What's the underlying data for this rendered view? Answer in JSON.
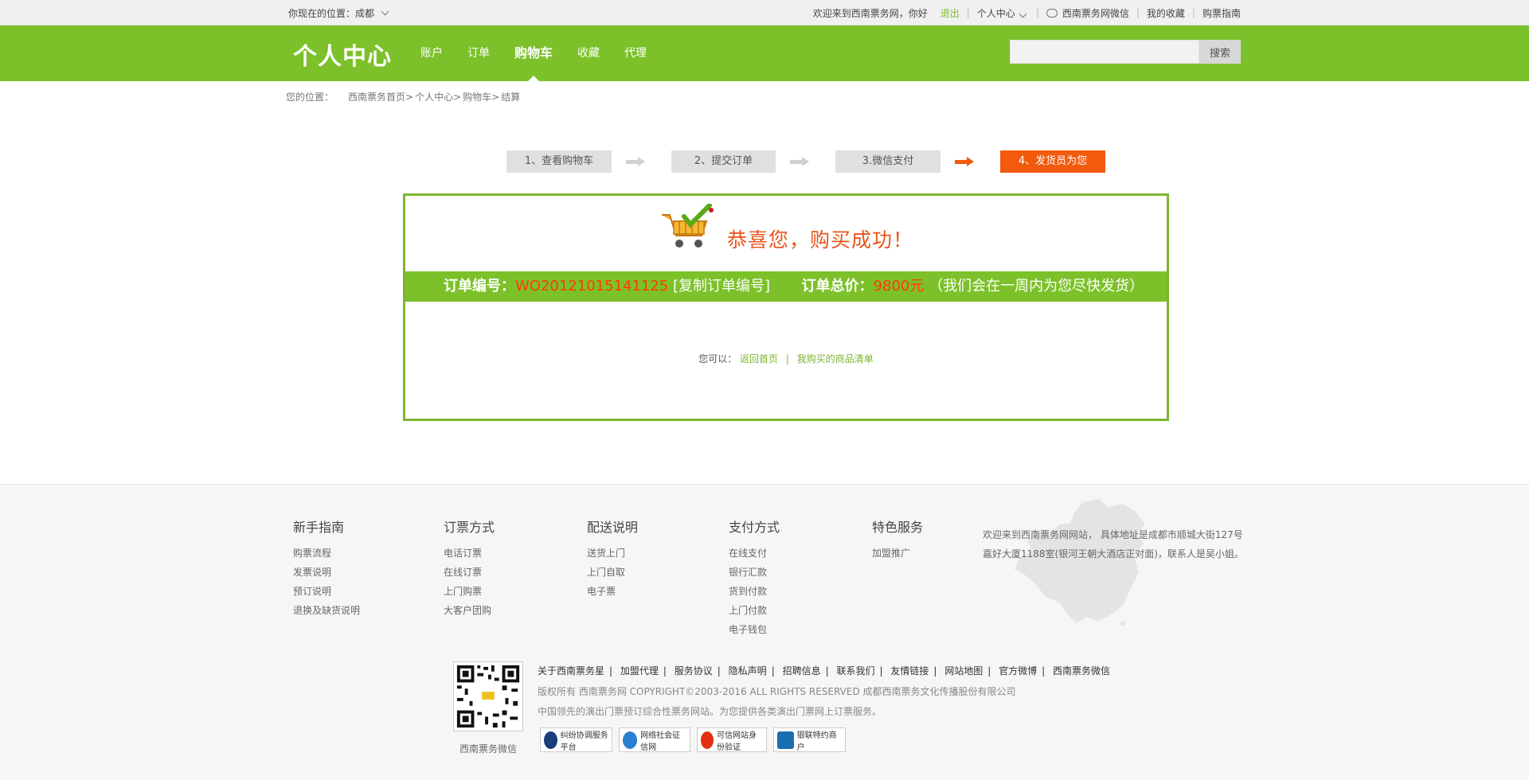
{
  "topbar": {
    "location_label": "你现在的位置：成都",
    "welcome": "欢迎来到西南票务网，你好",
    "logout": "退出",
    "personal_center": "个人中心",
    "wechat": "西南票务网微信",
    "favorites": "我的收藏",
    "guide": "购票指南"
  },
  "header": {
    "logo": "个人中心",
    "nav": [
      "账户",
      "订单",
      "购物车",
      "收藏",
      "代理"
    ],
    "active_nav": "购物车",
    "search_button": "搜索",
    "search_value": ""
  },
  "breadcrumb": {
    "label": "您的位置：",
    "items": [
      "西南票务首页>",
      "个人中心>",
      "购物车>",
      "结算"
    ]
  },
  "steps": [
    "1、查看购物车",
    "2、提交订单",
    "3.微信支付",
    "4、发货员为您发货"
  ],
  "success": {
    "title": "恭喜您，购买成功！",
    "order_no_label": "订单编号：",
    "order_no": "WO20121015141125",
    "copy_link": "[复制订单编号]",
    "total_label": "订单总价：",
    "total": "9800元",
    "note": "（我们会在一周内为您尽快发货）",
    "you_can": "您可以：",
    "back_home": "返回首页",
    "pipe": "|",
    "my_items": "我购买的商品清单"
  },
  "footer": {
    "columns": [
      {
        "title": "新手指南",
        "links": [
          "购票流程",
          "发票说明",
          "预订说明",
          "退换及缺货说明"
        ]
      },
      {
        "title": "订票方式",
        "links": [
          "电话订票",
          "在线订票",
          "上门购票",
          "大客户团购"
        ]
      },
      {
        "title": "配送说明",
        "links": [
          "送货上门",
          "上门自取",
          "电子票"
        ]
      },
      {
        "title": "支付方式",
        "links": [
          "在线支付",
          "银行汇款",
          "货到付款",
          "上门付款",
          "电子钱包"
        ]
      },
      {
        "title": "特色服务",
        "links": [
          "加盟推广"
        ]
      }
    ],
    "address": "欢迎来到西南票务网网站， 具体地址是成都市顺城大街127号嘉好大厦1188室(银河王朝大酒店正对面)，联系人是吴小姐。",
    "qr_caption": "西南票务微信",
    "links": [
      "关于西南票务星",
      "加盟代理",
      "服务协议",
      "隐私声明",
      "招聘信息",
      "联系我们",
      "友情链接",
      "网站地图",
      "官方微博",
      "西南票务微信"
    ],
    "copyright": "版权所有 西南票务网 COPYRIGHT©2003-2016 ALL RIGHTS RESERVED 成都西南票务文化传播股份有限公司",
    "slogan": "中国领先的演出门票预订综合性票务网站。为您提供各类演出门票网上订票服务。",
    "badges": [
      "纠纷协调服务平台",
      "网络社会征信网",
      "可信网站身份验证",
      "银联特约商户"
    ]
  },
  "colors": {
    "brand_green": "#7cc12a",
    "accent_orange": "#f25a0e",
    "price_red": "#ff3c00"
  }
}
